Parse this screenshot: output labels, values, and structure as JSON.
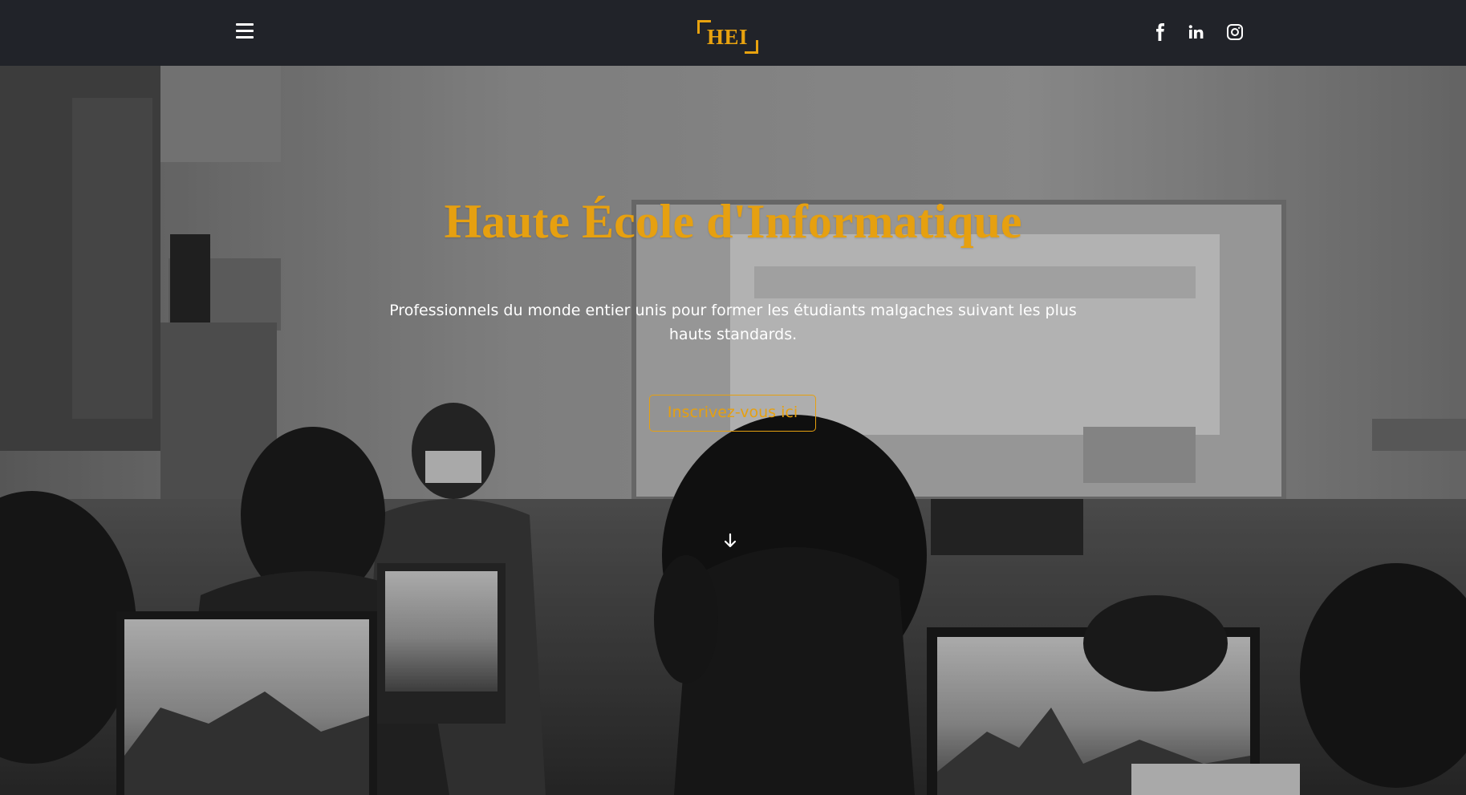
{
  "header": {
    "logo_text": "HEI",
    "social": [
      "facebook-icon",
      "linkedin-icon",
      "instagram-icon"
    ]
  },
  "hero": {
    "title": "Haute École d'Informatique",
    "subtitle": "Professionnels du monde entier unis pour former les étudiants malgaches suivant les plus hauts standards.",
    "cta_label": "Inscrivez-vous ici"
  },
  "colors": {
    "accent": "#e6a010",
    "header_bg": "#212329",
    "text_light": "#ffffff"
  }
}
